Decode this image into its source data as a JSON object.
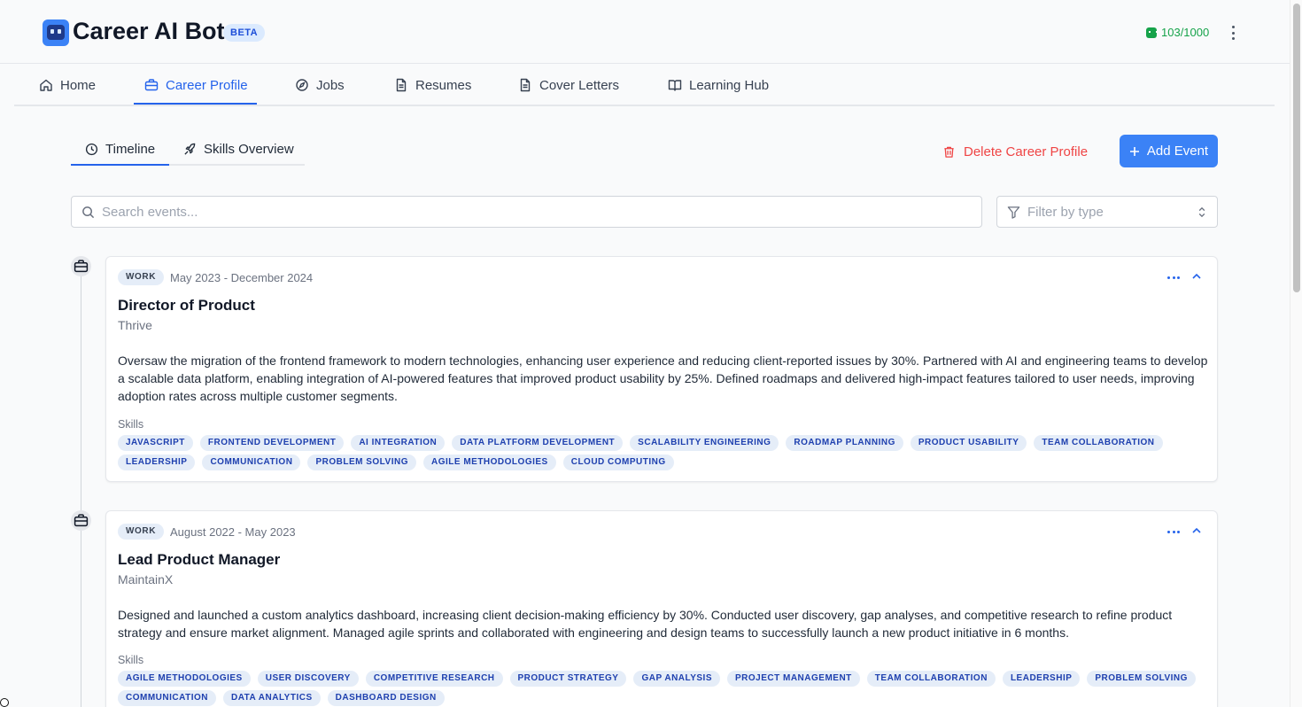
{
  "app": {
    "title": "Career AI Bot",
    "badge": "BETA",
    "credits": "103/1000"
  },
  "nav": {
    "items": [
      {
        "label": "Home",
        "icon": "home-icon"
      },
      {
        "label": "Career Profile",
        "icon": "briefcase-icon",
        "active": true
      },
      {
        "label": "Jobs",
        "icon": "compass-icon"
      },
      {
        "label": "Resumes",
        "icon": "document-icon"
      },
      {
        "label": "Cover Letters",
        "icon": "document-icon"
      },
      {
        "label": "Learning Hub",
        "icon": "book-icon"
      }
    ]
  },
  "subtabs": {
    "items": [
      {
        "label": "Timeline",
        "icon": "clock-icon",
        "active": true
      },
      {
        "label": "Skills Overview",
        "icon": "rocket-icon"
      }
    ]
  },
  "actions": {
    "delete_label": "Delete Career Profile",
    "add_label": "Add Event"
  },
  "search": {
    "placeholder": "Search events...",
    "value": ""
  },
  "filter": {
    "placeholder": "Filter by type"
  },
  "colors": {
    "accent": "#3b82f6",
    "danger": "#ef4444",
    "success": "#16a34a"
  },
  "events": [
    {
      "type": "WORK",
      "dates": "May 2023 - December 2024",
      "title": "Director of Product",
      "company": "Thrive",
      "description": "Oversaw the migration of the frontend framework to modern technologies, enhancing user experience and reducing client-reported issues by 30%. Partnered with AI and engineering teams to develop a scalable data platform, enabling integration of AI-powered features that improved product usability by 25%. Defined roadmaps and delivered high-impact features tailored to user needs, improving adoption rates across multiple customer segments.",
      "skills_label": "Skills",
      "skills": [
        "JAVASCRIPT",
        "FRONTEND DEVELOPMENT",
        "AI INTEGRATION",
        "DATA PLATFORM DEVELOPMENT",
        "SCALABILITY ENGINEERING",
        "ROADMAP PLANNING",
        "PRODUCT USABILITY",
        "TEAM COLLABORATION",
        "LEADERSHIP",
        "COMMUNICATION",
        "PROBLEM SOLVING",
        "AGILE METHODOLOGIES",
        "CLOUD COMPUTING"
      ]
    },
    {
      "type": "WORK",
      "dates": "August 2022 - May 2023",
      "title": "Lead Product Manager",
      "company": "MaintainX",
      "description": "Designed and launched a custom analytics dashboard, increasing client decision-making efficiency by 30%. Conducted user discovery, gap analyses, and competitive research to refine product strategy and ensure market alignment. Managed agile sprints and collaborated with engineering and design teams to successfully launch a new product initiative in 6 months.",
      "skills_label": "Skills",
      "skills": [
        "AGILE METHODOLOGIES",
        "USER DISCOVERY",
        "COMPETITIVE RESEARCH",
        "PRODUCT STRATEGY",
        "GAP ANALYSIS",
        "PROJECT MANAGEMENT",
        "TEAM COLLABORATION",
        "LEADERSHIP",
        "PROBLEM SOLVING",
        "COMMUNICATION",
        "DATA ANALYTICS",
        "DASHBOARD DESIGN"
      ]
    }
  ]
}
